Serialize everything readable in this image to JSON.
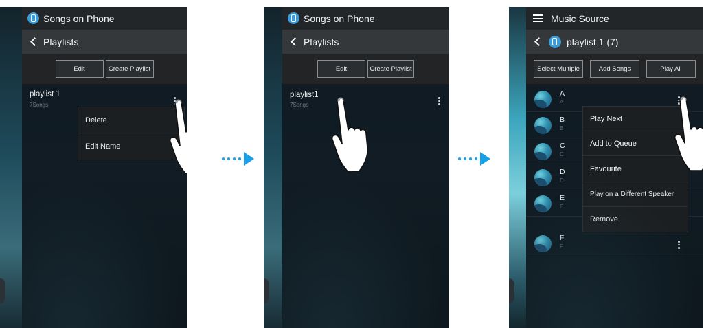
{
  "panels": [
    {
      "top_title": "Songs on Phone",
      "nav_label": "Playlists",
      "buttons": [
        "Edit",
        "Create Playlist"
      ],
      "playlist": {
        "name": "playlist 1",
        "count": "7Songs"
      },
      "menu": [
        "Delete",
        "Edit Name"
      ]
    },
    {
      "top_title": "Songs on Phone",
      "nav_label": "Playlists",
      "buttons": [
        "Edit",
        "Create Playlist"
      ],
      "playlist": {
        "name": "playlist1",
        "count": "7Songs"
      }
    },
    {
      "top_title": "Music Source",
      "nav_label": "playlist 1 (7)",
      "buttons": [
        "Select Multiple",
        "Add Songs",
        "Play All"
      ],
      "songs": [
        {
          "title": "A",
          "subtitle": "A"
        },
        {
          "title": "B",
          "subtitle": "B"
        },
        {
          "title": "C",
          "subtitle": "C"
        },
        {
          "title": "D",
          "subtitle": "D"
        },
        {
          "title": "E",
          "subtitle": "E"
        },
        {
          "title": "F",
          "subtitle": "F"
        }
      ],
      "menu": [
        "Play Next",
        "Add to Queue",
        "Favourite",
        "Play on a Different Speaker",
        "Remove"
      ]
    }
  ],
  "colors": {
    "accent": "#1aa0e6",
    "header": "#222629",
    "nav": "#34383b",
    "phone_icon": "#3c9ad6"
  },
  "icons": [
    "phone-icon",
    "back-chevron-icon",
    "hamburger-icon",
    "kebab-menu-icon",
    "album-art-icon",
    "pointing-hand-icon",
    "next-step-arrow-icon"
  ]
}
